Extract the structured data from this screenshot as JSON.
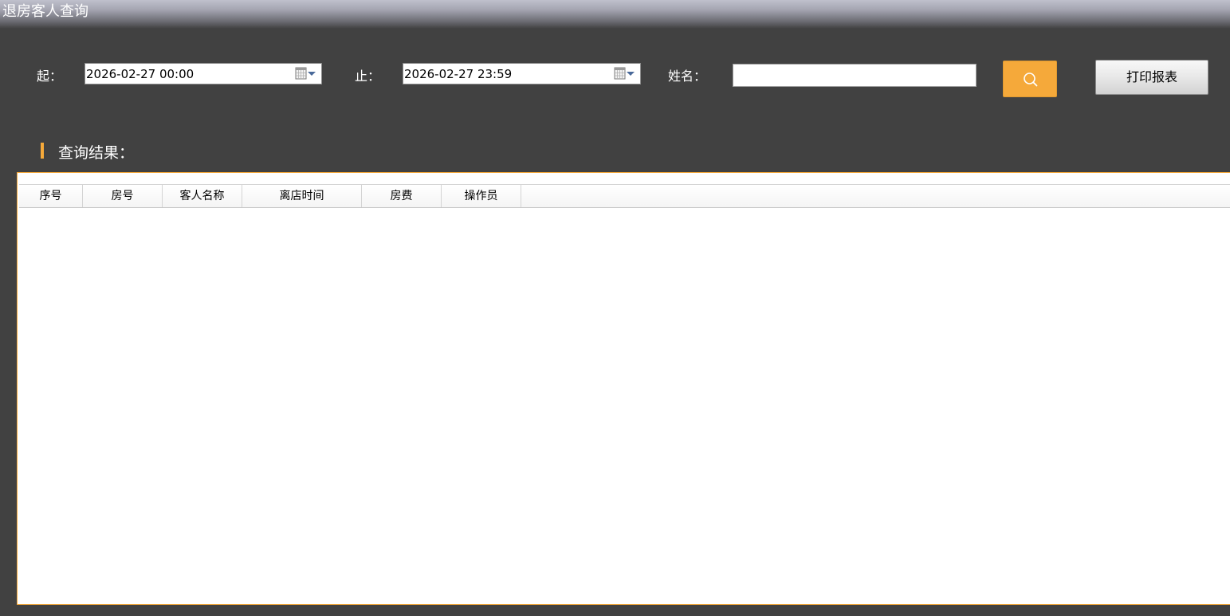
{
  "window": {
    "title": "退房客人查询"
  },
  "filters": {
    "start_label": "起：",
    "start_value": "2026-02-27 00:00",
    "end_label": "止：",
    "end_value": "2026-02-27 23:59",
    "name_label": "姓名：",
    "name_value": "",
    "search_icon": "search-icon",
    "calendar_icon": "calendar-dropdown-icon"
  },
  "toolbar": {
    "print_label": "打印报表"
  },
  "results": {
    "title": "查询结果：",
    "columns": [
      "序号",
      "房号",
      "客人名称",
      "离店时间",
      "房费",
      "操作员"
    ],
    "rows": []
  },
  "colors": {
    "background": "#414141",
    "accent": "#f5a93a"
  }
}
